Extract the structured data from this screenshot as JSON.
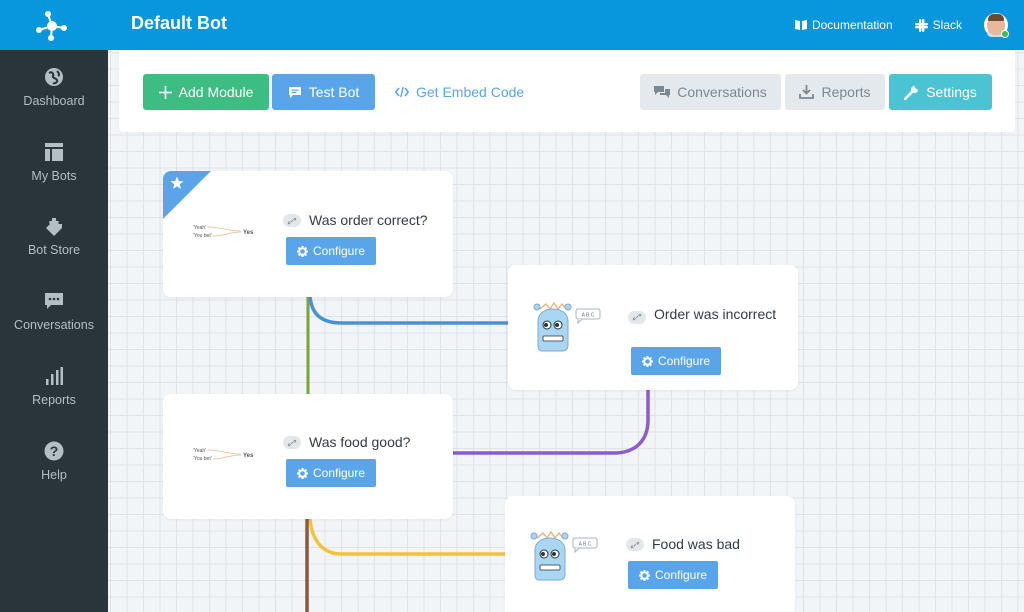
{
  "header": {
    "title": "Default Bot",
    "links": [
      {
        "label": "Documentation",
        "icon": "book-icon"
      },
      {
        "label": "Slack",
        "icon": "slack-icon"
      }
    ],
    "avatar": {
      "status": "online",
      "status_color": "#3cba54"
    }
  },
  "sidebar": {
    "items": [
      {
        "label": "Dashboard",
        "icon": "globe-icon"
      },
      {
        "label": "My Bots",
        "icon": "layout-icon"
      },
      {
        "label": "Bot Store",
        "icon": "puzzle-icon"
      },
      {
        "label": "Conversations",
        "icon": "chat-icon"
      },
      {
        "label": "Reports",
        "icon": "bar-chart-icon"
      },
      {
        "label": "Help",
        "icon": "help-icon"
      }
    ]
  },
  "toolbar": {
    "add_module": "Add Module",
    "test_bot": "Test Bot",
    "get_embed_code": "Get Embed Code",
    "conversations": "Conversations",
    "reports": "Reports",
    "settings": "Settings"
  },
  "colors": {
    "brand": "#0896dd",
    "sidebar": "#2a343b",
    "add": "#3dbd81",
    "primary": "#5aa5ea",
    "settings": "#4cc3d2",
    "secondary": "#e4e9ed"
  },
  "modules": [
    {
      "title": "Was order correct?",
      "type": "question",
      "starred": true,
      "graphic": {
        "option_a": "'Yeah'",
        "option_b": "'You bet'",
        "result": "Yes"
      },
      "configure_label": "Configure"
    },
    {
      "title": "Order was incorrect",
      "type": "response",
      "starred": false,
      "bubble": "A B C",
      "configure_label": "Configure"
    },
    {
      "title": "Was food good?",
      "type": "question",
      "starred": false,
      "graphic": {
        "option_a": "'Yeah'",
        "option_b": "'You bet'",
        "result": "Yes"
      },
      "configure_label": "Configure"
    },
    {
      "title": "Food was bad",
      "type": "response",
      "starred": false,
      "bubble": "A B C",
      "configure_label": "Configure"
    }
  ],
  "connections": [
    {
      "from": "Was order correct?",
      "to": "Was food good?",
      "color": "#7aa43a"
    },
    {
      "from": "Was order correct?",
      "to": "Order was incorrect",
      "color": "#4a90d9"
    },
    {
      "from": "Order was incorrect",
      "to": "Was food good?",
      "color": "#8a5cd0"
    },
    {
      "from": "Was food good?",
      "to": "Food was bad",
      "color": "#f4c13c"
    },
    {
      "from": "Was food good?",
      "to": "next",
      "color": "#8b5a3c"
    }
  ]
}
